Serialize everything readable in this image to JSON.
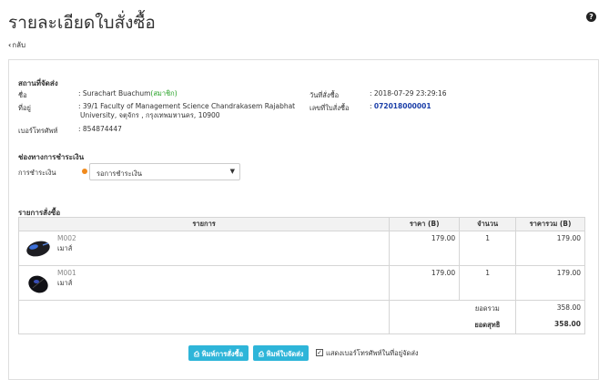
{
  "page": {
    "title": "รายละเอียดใบสั่งซื้อ",
    "back": "กลับ",
    "help_icon": "?"
  },
  "shipping": {
    "heading": "สถานที่จัดส่ง",
    "name_label": "ชื่อ",
    "name_value": ": Surachart Buachum",
    "member_tag": "(สมาชิก)",
    "address_label": "ที่อยู่",
    "address_line1": ": 39/1 Faculty of Management Science Chandrakasem Rajabhat",
    "address_line2": "University, จตุจักร , กรุงเทพมหานคร, 10900",
    "phone_label": "เบอร์โทรศัพท์",
    "phone_value": ": 854874447",
    "order_date_label": "วันที่สั่งซื้อ",
    "order_date_value": ": 2018-07-29 23:29:16",
    "order_no_label": "เลขที่ใบสั่งซื้อ",
    "order_no_prefix": ":",
    "order_no_value": "072018000001"
  },
  "payment": {
    "heading": "ช่องทางการชำระเงิน",
    "label": "การชำระเงิน",
    "status": "รอการชำระเงิน",
    "status_color": "#f08a1c"
  },
  "order": {
    "heading": "รายการสั่งซื้อ",
    "columns": [
      "รายการ",
      "ราคา (B)",
      "จำนวน",
      "ราคารวม (B)"
    ],
    "items": [
      {
        "code": "M002",
        "name": "เมาส์",
        "price": "179.00",
        "qty": "1",
        "total": "179.00"
      },
      {
        "code": "M001",
        "name": "เมาส์",
        "price": "179.00",
        "qty": "1",
        "total": "179.00"
      }
    ],
    "subtotal_label": "ยอดรวม",
    "subtotal_value": "358.00",
    "net_label": "ยอดสุทธิ",
    "net_value": "358.00"
  },
  "actions": {
    "print_order": "พิมพ์การสั่งซื้อ",
    "print_shipping": "พิมพ์ใบจัดส่ง",
    "show_phone_label": "แสดงเบอร์โทรศัพท์ในที่อยู่จัดส่ง",
    "show_phone_checked": true,
    "accent_color": "#2eb5d9"
  }
}
